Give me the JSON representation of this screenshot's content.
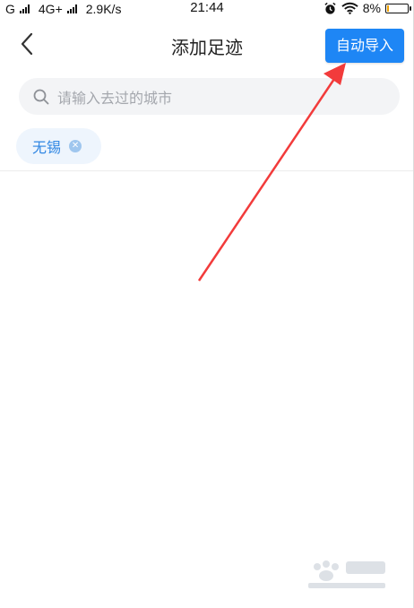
{
  "status_bar": {
    "carrier": "G",
    "network": "4G+",
    "speed": "2.9K/s",
    "time": "21:44",
    "battery": "8%",
    "battery_level": 0.08,
    "alarm_icon": "alarm-icon",
    "wifi_icon": "wifi-icon"
  },
  "nav": {
    "back_icon": "chevron-left-icon",
    "title": "添加足迹",
    "import_label": "自动导入"
  },
  "search": {
    "icon": "search-icon",
    "placeholder": "请输入去过的城市"
  },
  "tags": [
    {
      "label": "无锡",
      "close_icon": "close-icon"
    }
  ],
  "colors": {
    "accent": "#1e86f5",
    "tag_text": "#2f86e3",
    "tag_bg": "#eef5fd",
    "annotation_arrow": "#f23b3b"
  }
}
